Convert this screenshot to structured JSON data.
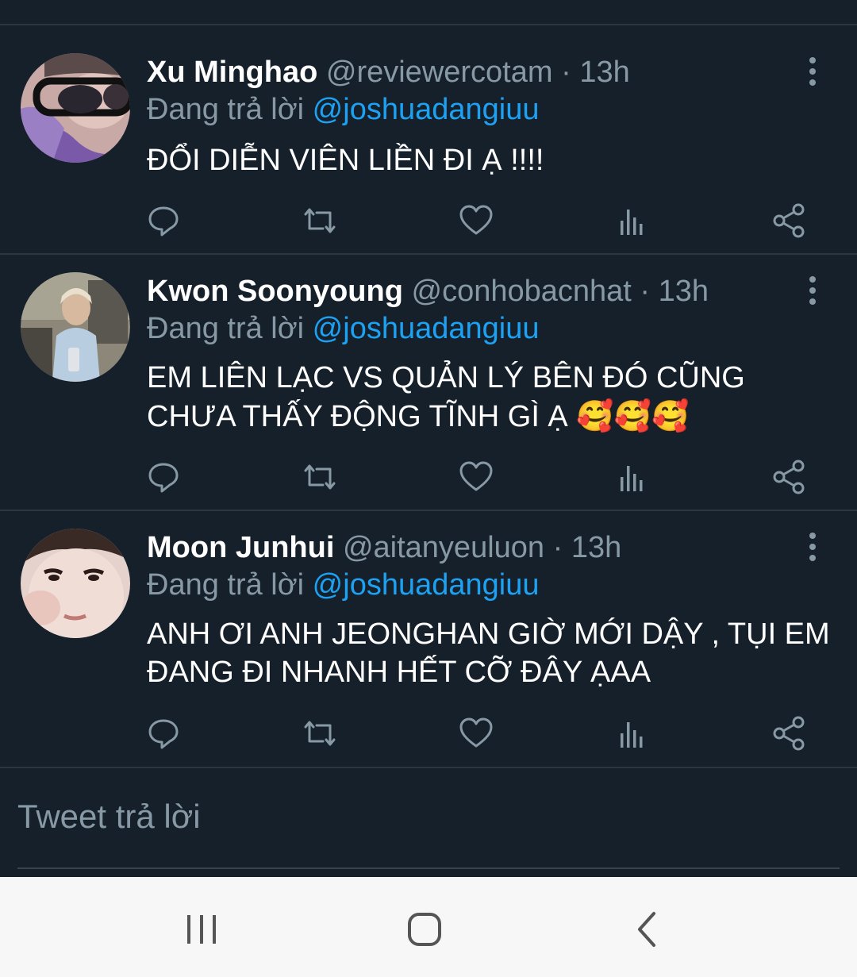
{
  "tweets": [
    {
      "name": "Xu Minghao",
      "handle": "@reviewercotam",
      "sep": "·",
      "time": "13h",
      "reply_prefix": "Đang trả lời",
      "reply_to": "@joshuadangiuu",
      "text": "ĐỔI DIỄN VIÊN LIỀN ĐI Ạ !!!!",
      "emoji": ""
    },
    {
      "name": "Kwon Soonyoung",
      "handle": "@conhobacnhat",
      "sep": "·",
      "time": "13h",
      "reply_prefix": "Đang trả lời",
      "reply_to": "@joshuadangiuu",
      "text": "EM LIÊN LẠC VS QUẢN LÝ BÊN ĐÓ CŨNG CHƯA THẤY ĐỘNG TĨNH GÌ Ạ",
      "emoji": "🥰🥰🥰"
    },
    {
      "name": "Moon Junhui",
      "handle": "@aitanyeuluon",
      "sep": "·",
      "time": "13h",
      "reply_prefix": "Đang trả lời",
      "reply_to": "@joshuadangiuu",
      "text": "ANH ƠI ANH JEONGHAN GIỜ MỚI DẬY , TỤI EM ĐANG ĐI NHANH HẾT CỠ ĐÂY ẠAA",
      "emoji": ""
    }
  ],
  "actions": [
    "reply-icon",
    "retweet-icon",
    "like-icon",
    "analytics-icon",
    "share-icon"
  ],
  "compose": {
    "placeholder": "Tweet trả lời"
  },
  "navbar": [
    "recent-apps-icon",
    "home-icon",
    "back-icon"
  ],
  "colors": {
    "background": "#15202b",
    "divider": "#2c3640",
    "secondary_text": "#8899a6",
    "accent": "#1da1f2",
    "navbar": "#f7f7f7"
  }
}
